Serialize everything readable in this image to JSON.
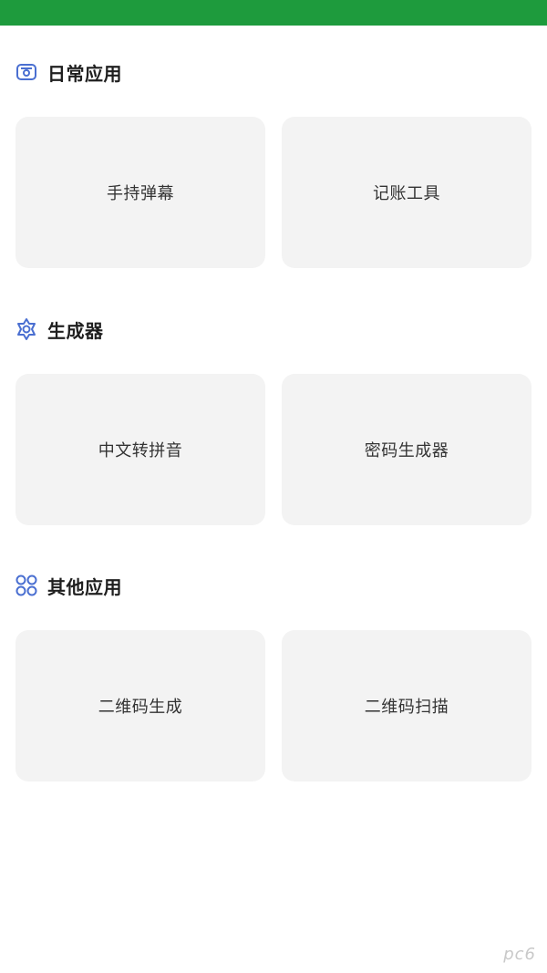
{
  "sections": [
    {
      "title": "日常应用",
      "icon": "app-window-icon",
      "items": [
        {
          "label": "手持弹幕"
        },
        {
          "label": "记账工具"
        }
      ]
    },
    {
      "title": "生成器",
      "icon": "gear-icon",
      "items": [
        {
          "label": "中文转拼音"
        },
        {
          "label": "密码生成器"
        }
      ]
    },
    {
      "title": "其他应用",
      "icon": "command-icon",
      "items": [
        {
          "label": "二维码生成"
        },
        {
          "label": "二维码扫描"
        }
      ]
    }
  ],
  "theme": {
    "topbar": "#1e9b3d",
    "icon": "#4a6fd1",
    "card_bg": "#f3f3f3"
  },
  "watermark": "pc6"
}
